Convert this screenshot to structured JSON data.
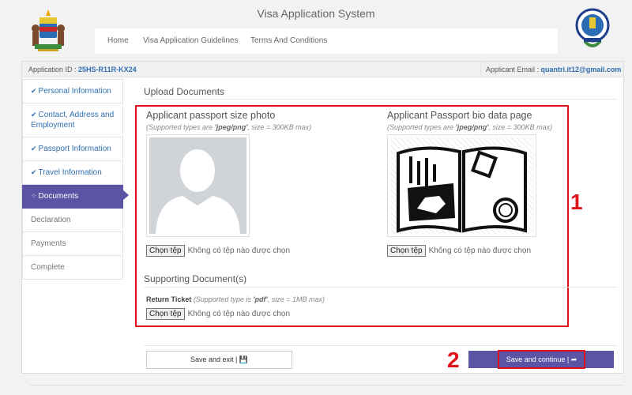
{
  "header": {
    "title": "Visa Application System",
    "nav": [
      "Home",
      "Visa Application Guidelines",
      "Terms And Conditions"
    ]
  },
  "application": {
    "id_label": "Application ID :",
    "id_value": "25HS-R11R-KX24",
    "email_label": "Applicant Email :",
    "email_value": "quantri.it12@gmail.com"
  },
  "sidebar": {
    "items": [
      {
        "label": "Personal Information",
        "status": "done"
      },
      {
        "label": "Contact, Address and Employment",
        "status": "done"
      },
      {
        "label": "Passport Information",
        "status": "done"
      },
      {
        "label": "Travel Information",
        "status": "done"
      },
      {
        "label": "Documents",
        "status": "active"
      },
      {
        "label": "Declaration",
        "status": "pending"
      },
      {
        "label": "Payments",
        "status": "pending"
      },
      {
        "label": "Complete",
        "status": "pending"
      }
    ]
  },
  "main": {
    "section_title": "Upload Documents",
    "photo": {
      "title": "Applicant passport size photo",
      "hint_prefix": "(Supported types are ",
      "hint_types": "'jpeg/png'",
      "hint_suffix": ", size = 300KB max)",
      "button": "Chọn tệp",
      "no_file": "Không có tệp nào được chọn"
    },
    "bio": {
      "title": "Applicant Passport bio data page",
      "hint_prefix": "(Supported types are ",
      "hint_types": "'jpeg/png'",
      "hint_suffix": ", size = 300KB max)",
      "button": "Chọn tệp",
      "no_file": "Không có tệp nào được chọn"
    },
    "supporting_title": "Supporting Document(s)",
    "ticket": {
      "label": "Return Ticket",
      "hint_prefix": " (Supported type is ",
      "hint_types": "'pdf'",
      "hint_suffix": ", size = 1MB max)",
      "button": "Chọn tệp",
      "no_file": "Không có tệp nào được chọn"
    },
    "save_exit": "Save and exit |",
    "save_continue": "Save and continue |"
  },
  "annotations": {
    "box1": "1",
    "box2": "2"
  },
  "colors": {
    "accent": "#5b54a4",
    "link": "#2e6fb0",
    "highlight": "#e0121c"
  }
}
